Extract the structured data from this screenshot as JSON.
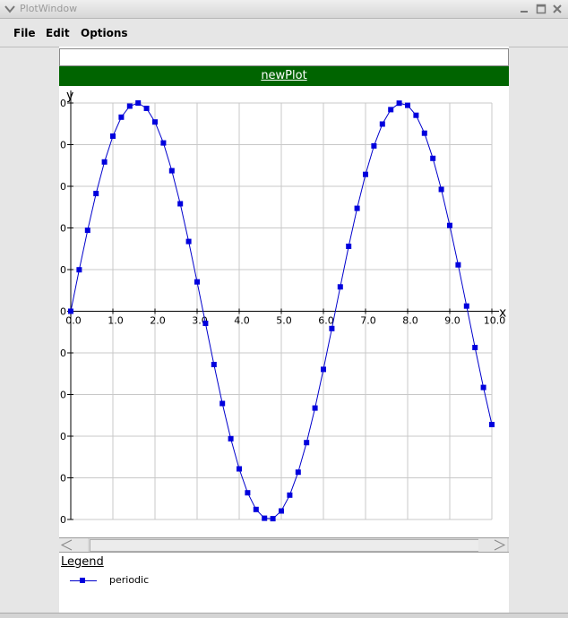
{
  "window": {
    "title": "PlotWindow"
  },
  "menu": {
    "file": "File",
    "edit": "Edit",
    "options": "Options"
  },
  "textfield": {
    "value": ""
  },
  "plot": {
    "title": "newPlot"
  },
  "legend": {
    "title": "Legend",
    "entries": [
      {
        "label": "periodic"
      }
    ]
  },
  "colors": {
    "title_bar": "#006400",
    "series": "#0000cc",
    "grid": "#c8c8c8"
  },
  "chart_data": {
    "type": "line",
    "xlabel": "x",
    "ylabel": "y",
    "xlim": [
      0,
      10
    ],
    "ylim": [
      -1,
      1
    ],
    "grid": true,
    "x_tick_labels": [
      "0.0",
      "1.0",
      "2.0",
      "3.0",
      "4.0",
      "5.0",
      "6.0",
      "7.0",
      "8.0",
      "9.0",
      "10.0"
    ],
    "y_tick_labels": [
      "0",
      "0",
      "0",
      "0",
      "0",
      "0",
      "0",
      "0",
      "0",
      "0",
      "0"
    ],
    "legend_placement": "bottom-left",
    "series": [
      {
        "name": "periodic",
        "marker": "square",
        "x": [
          0.0,
          0.2,
          0.4,
          0.6,
          0.8,
          1.0,
          1.2,
          1.4,
          1.6,
          1.8,
          2.0,
          2.2,
          2.4,
          2.6,
          2.8,
          3.0,
          3.2,
          3.4,
          3.6,
          3.8,
          4.0,
          4.2,
          4.4,
          4.6,
          4.8,
          5.0,
          5.2,
          5.4,
          5.6,
          5.8,
          6.0,
          6.2,
          6.4,
          6.6,
          6.8,
          7.0,
          7.2,
          7.4,
          7.6,
          7.8,
          8.0,
          8.2,
          8.4,
          8.6,
          8.8,
          9.0,
          9.2,
          9.4,
          9.6,
          9.8,
          10.0
        ],
        "y": [
          0.0,
          0.199,
          0.389,
          0.565,
          0.717,
          0.841,
          0.932,
          0.985,
          1.0,
          0.974,
          0.909,
          0.808,
          0.675,
          0.516,
          0.335,
          0.141,
          -0.058,
          -0.256,
          -0.443,
          -0.612,
          -0.757,
          -0.872,
          -0.952,
          -0.994,
          -0.996,
          -0.959,
          -0.883,
          -0.773,
          -0.631,
          -0.465,
          -0.279,
          -0.083,
          0.117,
          0.312,
          0.494,
          0.657,
          0.794,
          0.899,
          0.968,
          0.999,
          0.989,
          0.941,
          0.855,
          0.734,
          0.585,
          0.412,
          0.223,
          0.025,
          -0.174,
          -0.366,
          -0.544
        ]
      }
    ]
  }
}
